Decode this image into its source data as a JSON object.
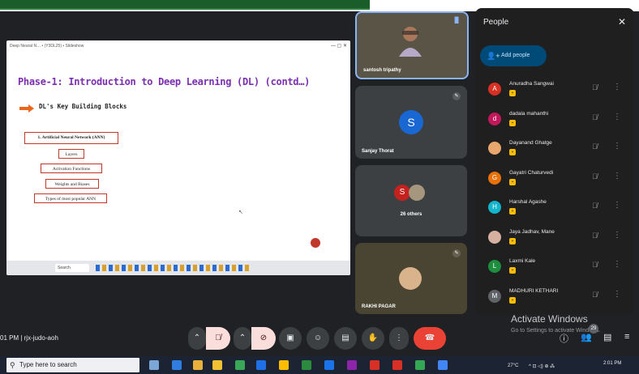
{
  "shared_window": {
    "title": "Deep Neural N… • (Y3DL25) • Slideshow",
    "slide_title": "Phase-1: Introduction to Deep Learning (DL) (contd…)",
    "subheading": "DL's Key Building Blocks",
    "main_box": "1. Artificial Neural Network (ANN)",
    "boxes": [
      "Layers",
      "Activation Functions",
      "Weights and Biases",
      "Types of most popular ANN"
    ],
    "taskbar_search": "Search"
  },
  "tiles": {
    "speaker": "santosh tripathy",
    "tile2_name": "Sanjay Thorat",
    "tile2_initial": "S",
    "tile3_initial": "S",
    "tile3_label": "26 others",
    "tile4_name": "RAKHI PAGAR"
  },
  "people_panel": {
    "title": "People",
    "close": "✕",
    "add_people": "Add people",
    "participants": [
      {
        "name": "Anuradha Sangwai",
        "initial": "A",
        "color": "#d93025"
      },
      {
        "name": "dadala mahanthi",
        "initial": "d",
        "color": "#c2185b"
      },
      {
        "name": "Dayanand Ghatge",
        "initial": "",
        "color": "#e8a66c"
      },
      {
        "name": "Gayatri Chaturvedi",
        "initial": "G",
        "color": "#e8710a"
      },
      {
        "name": "Harshal Agashe",
        "initial": "H",
        "color": "#12b5cb"
      },
      {
        "name": "Jaya Jadhav, Mane",
        "initial": "",
        "color": "#d6b0a0"
      },
      {
        "name": "Laxmi Kale",
        "initial": "L",
        "color": "#1e8e3e"
      },
      {
        "name": "MADHURI KETHARI",
        "initial": "M",
        "color": "#5f6368"
      }
    ]
  },
  "bottom": {
    "meeting_info": "01 PM  |  rjx-judo-aoh",
    "activate_title": "Activate Windows",
    "activate_sub": "Go to Settings to activate Windows.",
    "badge_count": "29"
  },
  "windows_taskbar": {
    "search_placeholder": "Type here to search",
    "weather": "27°C",
    "time": "2:01 PM"
  }
}
